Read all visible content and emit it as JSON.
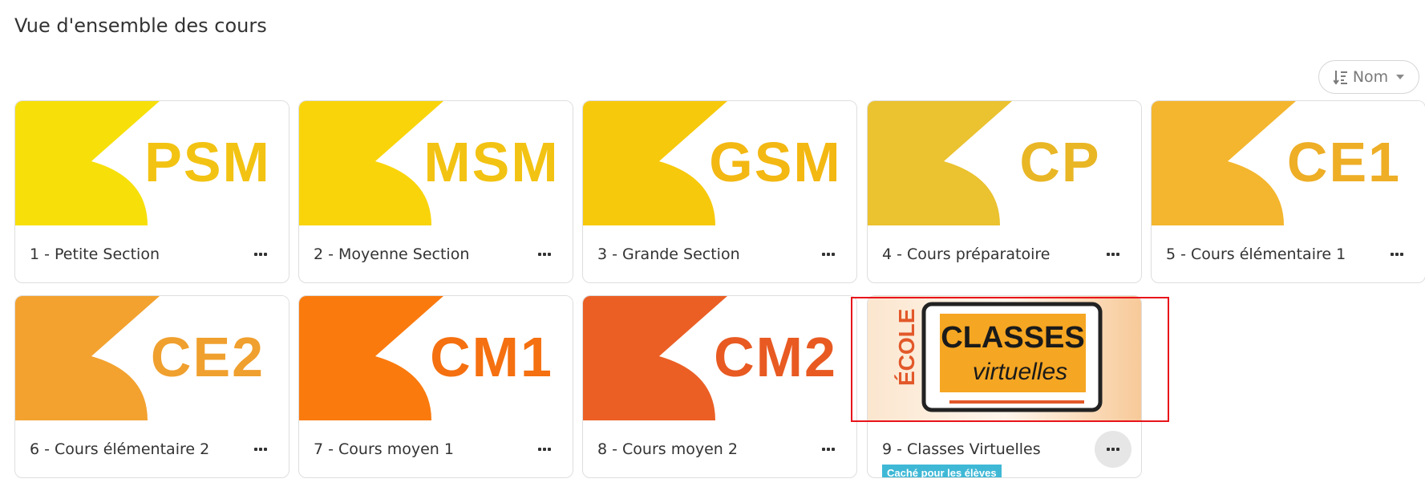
{
  "page": {
    "title": "Vue d'ensemble des cours"
  },
  "sort": {
    "label": "Nom",
    "icon": "sort-alpha-icon"
  },
  "courses": [
    {
      "name": "1 - Petite Section",
      "code": "PSM",
      "bg": "#f7df0a",
      "fg": "#f3c313"
    },
    {
      "name": "2 - Moyenne Section",
      "code": "MSM",
      "bg": "#f9d40a",
      "fg": "#f3c313"
    },
    {
      "name": "3 - Grande Section",
      "code": "GSM",
      "bg": "#f7c90c",
      "fg": "#f3b812"
    },
    {
      "name": "4 - Cours préparatoire",
      "code": "CP",
      "bg": "#ebc22f",
      "fg": "#e9b625"
    },
    {
      "name": "5 - Cours élémentaire 1",
      "code": "CE1",
      "bg": "#f4b62e",
      "fg": "#eeae26"
    },
    {
      "name": "6 - Cours élémentaire 2",
      "code": "CE2",
      "bg": "#f3a22f",
      "fg": "#f0a02e"
    },
    {
      "name": "7 - Cours moyen 1",
      "code": "CM1",
      "bg": "#fa7a0e",
      "fg": "#f57010"
    },
    {
      "name": "8 - Cours moyen 2",
      "code": "CM2",
      "bg": "#eb5f25",
      "fg": "#e85a22"
    },
    {
      "name": "9 - Classes Virtuelles",
      "code": "",
      "badge": "Caché pour les élèves"
    }
  ],
  "virtual_image": {
    "side_text": "ÉCOLE",
    "line1": "CLASSES",
    "line2": "virtuelles",
    "accent": "#f5a623"
  }
}
